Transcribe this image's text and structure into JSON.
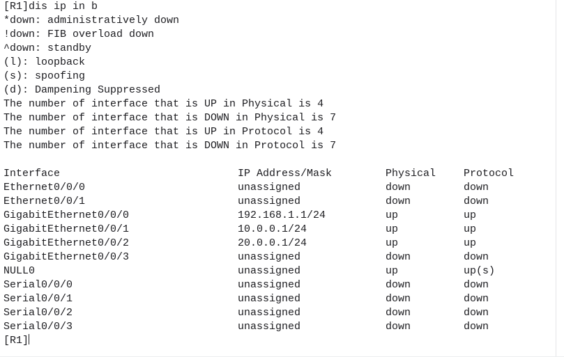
{
  "terminal": {
    "command_line": "[R1]dis ip in b",
    "legend": [
      "*down: administratively down",
      "!down: FIB overload down",
      "^down: standby",
      "(l): loopback",
      "(s): spoofing",
      "(d): Dampening Suppressed"
    ],
    "summary": [
      "The number of interface that is UP in Physical is 4",
      "The number of interface that is DOWN in Physical is 7",
      "The number of interface that is UP in Protocol is 4",
      "The number of interface that is DOWN in Protocol is 7"
    ],
    "summary_counts": {
      "up_physical": "4",
      "down_physical": "7",
      "up_protocol": "4",
      "down_protocol": "7"
    },
    "table": {
      "headers": {
        "interface": "Interface",
        "ip": "IP Address/Mask",
        "physical": "Physical",
        "protocol": "Protocol"
      },
      "rows": [
        {
          "interface": "Ethernet0/0/0",
          "ip": "unassigned",
          "physical": "down",
          "protocol": "down"
        },
        {
          "interface": "Ethernet0/0/1",
          "ip": "unassigned",
          "physical": "down",
          "protocol": "down"
        },
        {
          "interface": "GigabitEthernet0/0/0",
          "ip": "192.168.1.1/24",
          "physical": "up",
          "protocol": "up"
        },
        {
          "interface": "GigabitEthernet0/0/1",
          "ip": "10.0.0.1/24",
          "physical": "up",
          "protocol": "up"
        },
        {
          "interface": "GigabitEthernet0/0/2",
          "ip": "20.0.0.1/24",
          "physical": "up",
          "protocol": "up"
        },
        {
          "interface": "GigabitEthernet0/0/3",
          "ip": "unassigned",
          "physical": "down",
          "protocol": "down"
        },
        {
          "interface": "NULL0",
          "ip": "unassigned",
          "physical": "up",
          "protocol": "up(s)"
        },
        {
          "interface": "Serial0/0/0",
          "ip": "unassigned",
          "physical": "down",
          "protocol": "down"
        },
        {
          "interface": "Serial0/0/1",
          "ip": "unassigned",
          "physical": "down",
          "protocol": "down"
        },
        {
          "interface": "Serial0/0/2",
          "ip": "unassigned",
          "physical": "down",
          "protocol": "down"
        },
        {
          "interface": "Serial0/0/3",
          "ip": "unassigned",
          "physical": "down",
          "protocol": "down"
        }
      ]
    },
    "trailing_prompt": "[R1]",
    "colors": {
      "background": "#ffffff",
      "text": "#1b1b1f",
      "border": "#e3e5e8"
    }
  }
}
